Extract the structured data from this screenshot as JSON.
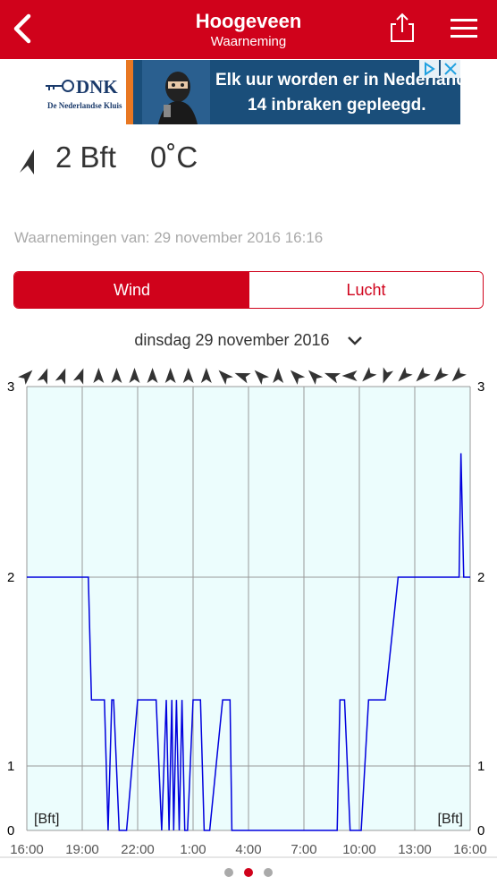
{
  "header": {
    "title": "Hoogeveen",
    "subtitle": "Waarneming",
    "back_icon": "chevron-left-icon",
    "share_icon": "share-icon",
    "menu_icon": "hamburger-menu-icon",
    "background_color": "#d0021b"
  },
  "ad": {
    "brand": "DNK",
    "brand_sub": "De Nederlandse Kluis",
    "line1": "Elk uur worden er in Nederland",
    "line2": "14 inbraken gepleegd."
  },
  "current": {
    "wind": "2 Bft",
    "temperature": "0˚C"
  },
  "observation": {
    "text": "Waarnemingen van: 29 november 2016 16:16"
  },
  "tabs": [
    {
      "label": "Wind",
      "selected": true
    },
    {
      "label": "Lucht",
      "selected": false
    }
  ],
  "date_selector": {
    "label": "dinsdag 29 november 2016",
    "icon": "chevron-down-icon"
  },
  "chart_data": {
    "type": "line",
    "unit_label": "[Bft]",
    "ylim": [
      0,
      3
    ],
    "y_ticks": [
      "3",
      "2",
      "1",
      "0"
    ],
    "x_ticks": [
      "16:00",
      "19:00",
      "22:00",
      "1:00",
      "4:00",
      "7:00",
      "10:00",
      "13:00",
      "16:00"
    ],
    "x_hours": [
      0,
      24
    ],
    "line_color": "#0000dd",
    "fill_color": "#ecfdfd",
    "grid": true,
    "wind_direction_deg": [
      45,
      20,
      20,
      20,
      0,
      0,
      0,
      0,
      0,
      0,
      0,
      315,
      290,
      315,
      0,
      315,
      315,
      290,
      270,
      225,
      200,
      225,
      225,
      225,
      225
    ],
    "series": [
      {
        "x": [
          0,
          3.33,
          3.5,
          4.2,
          4.4,
          4.6,
          4.7,
          5.0,
          5.4,
          6.0,
          7.0,
          7.3,
          7.55,
          7.7,
          7.85,
          7.95,
          8.1,
          8.25,
          8.4,
          8.55,
          8.7,
          9.0,
          9.4,
          9.6,
          9.9,
          10.6,
          11.0,
          11.1,
          11.2,
          16.8,
          16.95,
          17.2,
          17.5,
          18.1,
          18.5,
          19.4,
          20.1,
          20.8,
          23.4,
          23.5,
          23.65,
          24.0
        ],
        "y": [
          2,
          2,
          1.35,
          1.35,
          0,
          1.35,
          1.35,
          0,
          0,
          1.35,
          1.35,
          0,
          1.35,
          0,
          1.35,
          0,
          1.35,
          0,
          1.35,
          0,
          0,
          1.35,
          1.35,
          0,
          0,
          1.35,
          1.35,
          0,
          0,
          0,
          1.35,
          1.35,
          0,
          0,
          1.35,
          1.35,
          2,
          2,
          2,
          2.65,
          2,
          2
        ]
      }
    ]
  }
}
